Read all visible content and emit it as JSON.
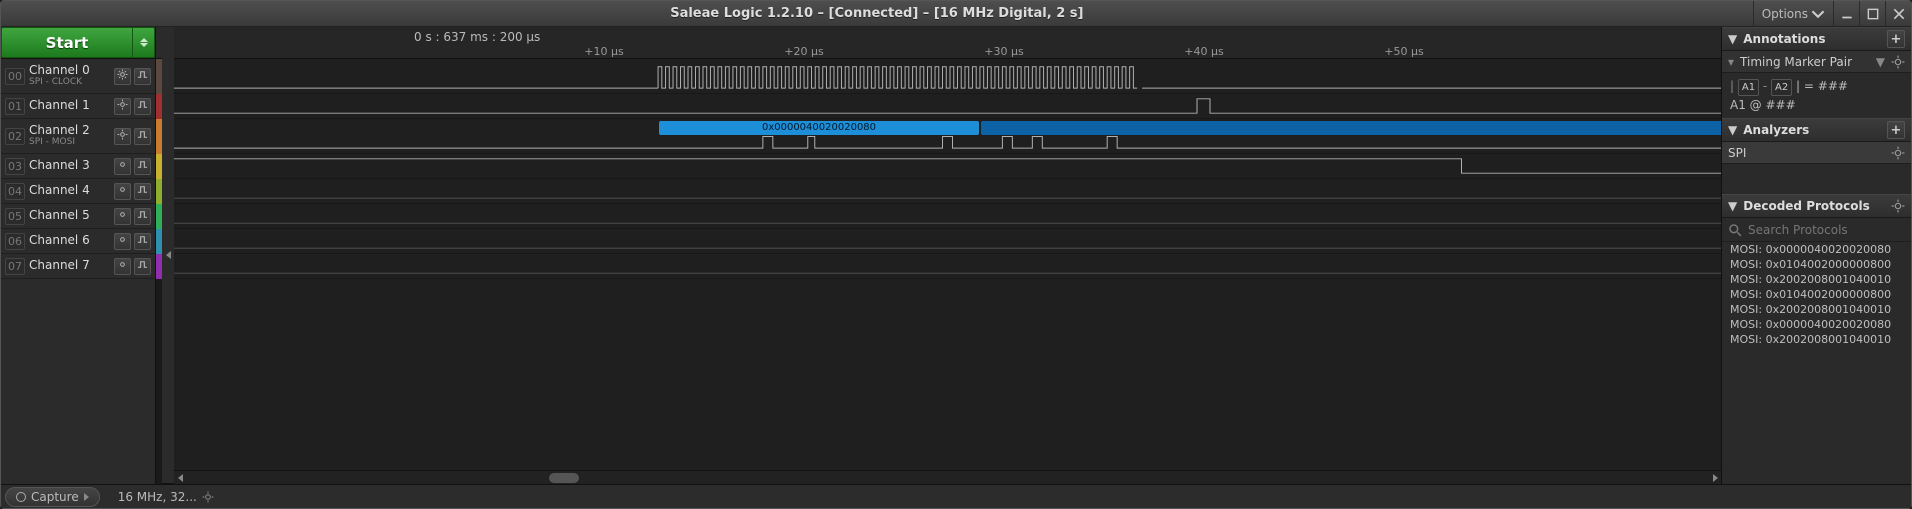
{
  "window": {
    "title": "Saleae Logic 1.2.10 – [Connected] – [16 MHz Digital, 2 s]",
    "options_label": "Options"
  },
  "toolbar": {
    "start_label": "Start"
  },
  "timeline": {
    "position": "0 s : 637 ms : 200 µs",
    "ticks": [
      "+10 µs",
      "+20 µs",
      "+30 µs",
      "+40 µs",
      "+50 µs"
    ]
  },
  "channels": [
    {
      "idx": "00",
      "name": "Channel 0",
      "sub": "SPI - CLOCK",
      "color": "#59493f"
    },
    {
      "idx": "01",
      "name": "Channel 1",
      "sub": "",
      "color": "#a03030"
    },
    {
      "idx": "02",
      "name": "Channel 2",
      "sub": "SPI - MOSI",
      "color": "#c97b2f"
    },
    {
      "idx": "03",
      "name": "Channel 3",
      "sub": "",
      "color": "#c7b12f"
    },
    {
      "idx": "04",
      "name": "Channel 4",
      "sub": "",
      "color": "#8fae2f"
    },
    {
      "idx": "05",
      "name": "Channel 5",
      "sub": "",
      "color": "#2fae5a"
    },
    {
      "idx": "06",
      "name": "Channel 6",
      "sub": "",
      "color": "#2f8fae"
    },
    {
      "idx": "07",
      "name": "Channel 7",
      "sub": "",
      "color": "#8f2fae"
    }
  ],
  "decode_overlay": {
    "label": "0x0000040020020080"
  },
  "right": {
    "annotations": {
      "header": "Annotations",
      "sub": "Timing Marker Pair",
      "line1_a": "A1",
      "line1_b": "A2",
      "line1_rest": " | = ###",
      "line2": "A1  @  ###"
    },
    "analyzers": {
      "header": "Analyzers",
      "item": "SPI"
    },
    "decoded": {
      "header": "Decoded Protocols",
      "search_placeholder": "Search Protocols",
      "items": [
        "MOSI: 0x0000040020020080",
        "MOSI: 0x0104002000000800",
        "MOSI: 0x2002008001040010",
        "MOSI: 0x0104002000000800",
        "MOSI: 0x2002008001040010",
        "MOSI: 0x0000040020020080",
        "MOSI: 0x2002008001040010"
      ]
    }
  },
  "bottom": {
    "capture_label": "Capture",
    "rate_label": "16 MHz, 32..."
  }
}
